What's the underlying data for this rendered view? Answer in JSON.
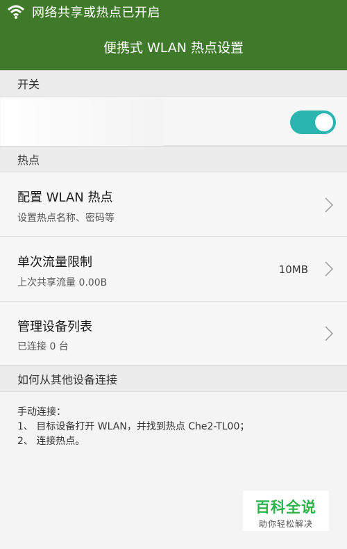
{
  "status_bar": {
    "message": "网络共享或热点已开启",
    "icon": "wifi-hotspot-icon"
  },
  "title_bar": {
    "title": "便携式 WLAN 热点设置"
  },
  "sections": {
    "switch": {
      "label": "开关"
    },
    "hotspot": {
      "label": "热点"
    },
    "how_to_connect": {
      "label": "如何从其他设备连接"
    }
  },
  "switch_row": {
    "state": "on",
    "accent": "#2ab5b0"
  },
  "rows": [
    {
      "title": "配置 WLAN 热点",
      "subtitle": "设置热点名称、密码等",
      "value": ""
    },
    {
      "title": "单次流量限制",
      "subtitle": "上次共享流量 0.00B",
      "value": "10MB"
    },
    {
      "title": "管理设备列表",
      "subtitle": "已连接 0 台",
      "value": ""
    }
  ],
  "help": {
    "heading": "手动连接：",
    "step1": "1、 目标设备打开 WLAN，并找到热点 Che2-TL00；",
    "step2": "2、 连接热点。"
  },
  "watermark": {
    "logo": "百科全说",
    "slogan": "助你轻松解决"
  },
  "colors": {
    "header_green": "#3f7a2a",
    "toggle_teal": "#2ab5b0"
  }
}
